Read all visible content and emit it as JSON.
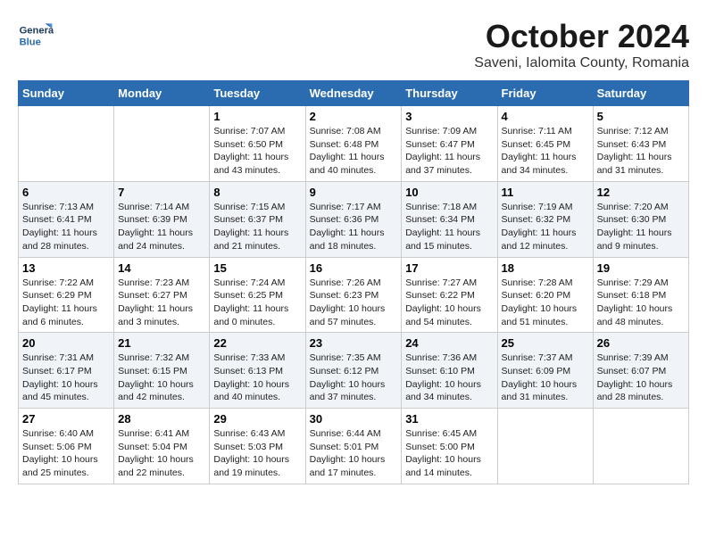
{
  "header": {
    "logo_line1": "General",
    "logo_line2": "Blue",
    "month": "October 2024",
    "location": "Saveni, Ialomita County, Romania"
  },
  "days_of_week": [
    "Sunday",
    "Monday",
    "Tuesday",
    "Wednesday",
    "Thursday",
    "Friday",
    "Saturday"
  ],
  "weeks": [
    [
      {
        "day": "",
        "sunrise": "",
        "sunset": "",
        "daylight": ""
      },
      {
        "day": "",
        "sunrise": "",
        "sunset": "",
        "daylight": ""
      },
      {
        "day": "1",
        "sunrise": "Sunrise: 7:07 AM",
        "sunset": "Sunset: 6:50 PM",
        "daylight": "Daylight: 11 hours and 43 minutes."
      },
      {
        "day": "2",
        "sunrise": "Sunrise: 7:08 AM",
        "sunset": "Sunset: 6:48 PM",
        "daylight": "Daylight: 11 hours and 40 minutes."
      },
      {
        "day": "3",
        "sunrise": "Sunrise: 7:09 AM",
        "sunset": "Sunset: 6:47 PM",
        "daylight": "Daylight: 11 hours and 37 minutes."
      },
      {
        "day": "4",
        "sunrise": "Sunrise: 7:11 AM",
        "sunset": "Sunset: 6:45 PM",
        "daylight": "Daylight: 11 hours and 34 minutes."
      },
      {
        "day": "5",
        "sunrise": "Sunrise: 7:12 AM",
        "sunset": "Sunset: 6:43 PM",
        "daylight": "Daylight: 11 hours and 31 minutes."
      }
    ],
    [
      {
        "day": "6",
        "sunrise": "Sunrise: 7:13 AM",
        "sunset": "Sunset: 6:41 PM",
        "daylight": "Daylight: 11 hours and 28 minutes."
      },
      {
        "day": "7",
        "sunrise": "Sunrise: 7:14 AM",
        "sunset": "Sunset: 6:39 PM",
        "daylight": "Daylight: 11 hours and 24 minutes."
      },
      {
        "day": "8",
        "sunrise": "Sunrise: 7:15 AM",
        "sunset": "Sunset: 6:37 PM",
        "daylight": "Daylight: 11 hours and 21 minutes."
      },
      {
        "day": "9",
        "sunrise": "Sunrise: 7:17 AM",
        "sunset": "Sunset: 6:36 PM",
        "daylight": "Daylight: 11 hours and 18 minutes."
      },
      {
        "day": "10",
        "sunrise": "Sunrise: 7:18 AM",
        "sunset": "Sunset: 6:34 PM",
        "daylight": "Daylight: 11 hours and 15 minutes."
      },
      {
        "day": "11",
        "sunrise": "Sunrise: 7:19 AM",
        "sunset": "Sunset: 6:32 PM",
        "daylight": "Daylight: 11 hours and 12 minutes."
      },
      {
        "day": "12",
        "sunrise": "Sunrise: 7:20 AM",
        "sunset": "Sunset: 6:30 PM",
        "daylight": "Daylight: 11 hours and 9 minutes."
      }
    ],
    [
      {
        "day": "13",
        "sunrise": "Sunrise: 7:22 AM",
        "sunset": "Sunset: 6:29 PM",
        "daylight": "Daylight: 11 hours and 6 minutes."
      },
      {
        "day": "14",
        "sunrise": "Sunrise: 7:23 AM",
        "sunset": "Sunset: 6:27 PM",
        "daylight": "Daylight: 11 hours and 3 minutes."
      },
      {
        "day": "15",
        "sunrise": "Sunrise: 7:24 AM",
        "sunset": "Sunset: 6:25 PM",
        "daylight": "Daylight: 11 hours and 0 minutes."
      },
      {
        "day": "16",
        "sunrise": "Sunrise: 7:26 AM",
        "sunset": "Sunset: 6:23 PM",
        "daylight": "Daylight: 10 hours and 57 minutes."
      },
      {
        "day": "17",
        "sunrise": "Sunrise: 7:27 AM",
        "sunset": "Sunset: 6:22 PM",
        "daylight": "Daylight: 10 hours and 54 minutes."
      },
      {
        "day": "18",
        "sunrise": "Sunrise: 7:28 AM",
        "sunset": "Sunset: 6:20 PM",
        "daylight": "Daylight: 10 hours and 51 minutes."
      },
      {
        "day": "19",
        "sunrise": "Sunrise: 7:29 AM",
        "sunset": "Sunset: 6:18 PM",
        "daylight": "Daylight: 10 hours and 48 minutes."
      }
    ],
    [
      {
        "day": "20",
        "sunrise": "Sunrise: 7:31 AM",
        "sunset": "Sunset: 6:17 PM",
        "daylight": "Daylight: 10 hours and 45 minutes."
      },
      {
        "day": "21",
        "sunrise": "Sunrise: 7:32 AM",
        "sunset": "Sunset: 6:15 PM",
        "daylight": "Daylight: 10 hours and 42 minutes."
      },
      {
        "day": "22",
        "sunrise": "Sunrise: 7:33 AM",
        "sunset": "Sunset: 6:13 PM",
        "daylight": "Daylight: 10 hours and 40 minutes."
      },
      {
        "day": "23",
        "sunrise": "Sunrise: 7:35 AM",
        "sunset": "Sunset: 6:12 PM",
        "daylight": "Daylight: 10 hours and 37 minutes."
      },
      {
        "day": "24",
        "sunrise": "Sunrise: 7:36 AM",
        "sunset": "Sunset: 6:10 PM",
        "daylight": "Daylight: 10 hours and 34 minutes."
      },
      {
        "day": "25",
        "sunrise": "Sunrise: 7:37 AM",
        "sunset": "Sunset: 6:09 PM",
        "daylight": "Daylight: 10 hours and 31 minutes."
      },
      {
        "day": "26",
        "sunrise": "Sunrise: 7:39 AM",
        "sunset": "Sunset: 6:07 PM",
        "daylight": "Daylight: 10 hours and 28 minutes."
      }
    ],
    [
      {
        "day": "27",
        "sunrise": "Sunrise: 6:40 AM",
        "sunset": "Sunset: 5:06 PM",
        "daylight": "Daylight: 10 hours and 25 minutes."
      },
      {
        "day": "28",
        "sunrise": "Sunrise: 6:41 AM",
        "sunset": "Sunset: 5:04 PM",
        "daylight": "Daylight: 10 hours and 22 minutes."
      },
      {
        "day": "29",
        "sunrise": "Sunrise: 6:43 AM",
        "sunset": "Sunset: 5:03 PM",
        "daylight": "Daylight: 10 hours and 19 minutes."
      },
      {
        "day": "30",
        "sunrise": "Sunrise: 6:44 AM",
        "sunset": "Sunset: 5:01 PM",
        "daylight": "Daylight: 10 hours and 17 minutes."
      },
      {
        "day": "31",
        "sunrise": "Sunrise: 6:45 AM",
        "sunset": "Sunset: 5:00 PM",
        "daylight": "Daylight: 10 hours and 14 minutes."
      },
      {
        "day": "",
        "sunrise": "",
        "sunset": "",
        "daylight": ""
      },
      {
        "day": "",
        "sunrise": "",
        "sunset": "",
        "daylight": ""
      }
    ]
  ]
}
